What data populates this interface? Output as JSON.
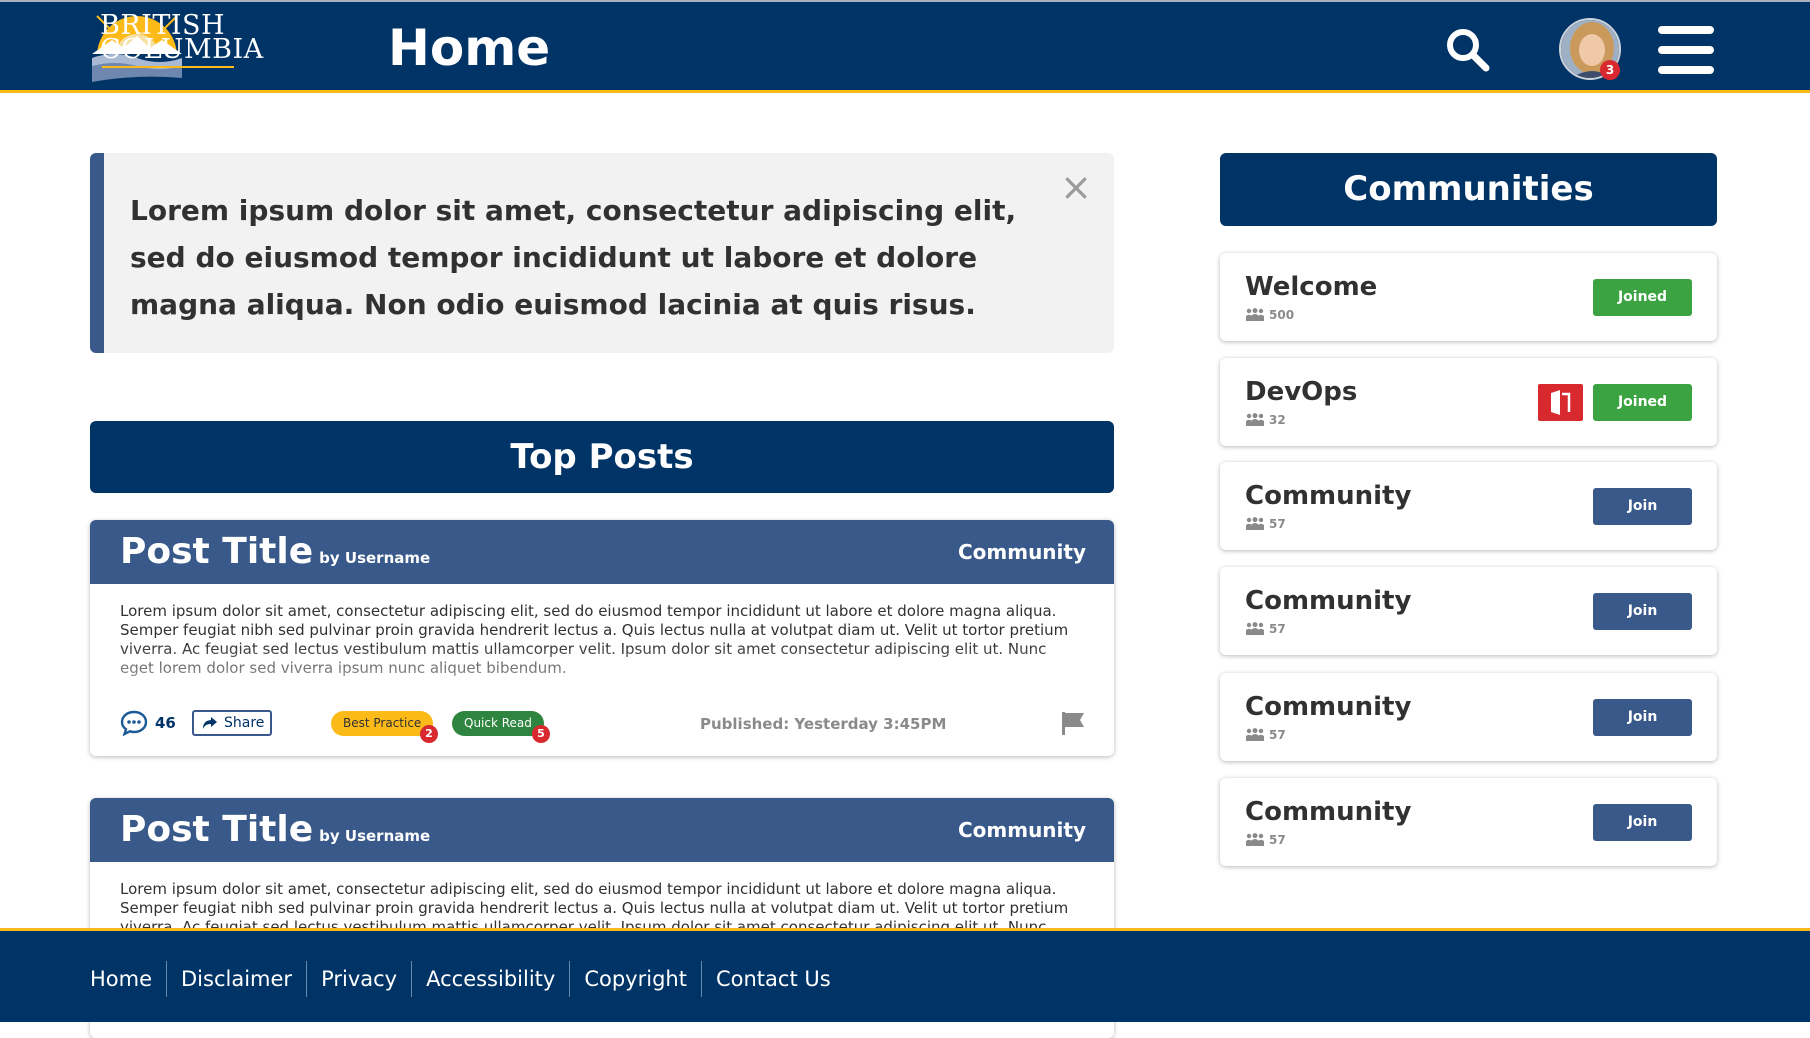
{
  "header": {
    "logo_line1": "BRITISH",
    "logo_line2": "COLUMBIA",
    "title": "Home",
    "notification_count": "3"
  },
  "banner": {
    "text": "Lorem ipsum dolor sit amet, consectetur adipiscing elit, sed do eiusmod tempor incididunt ut labore et dolore magna aliqua. Non odio euismod lacinia at quis risus.",
    "close_label": "×"
  },
  "top_posts": {
    "heading": "Top Posts",
    "posts": [
      {
        "title": "Post Title",
        "by": "by Username",
        "community": "Community",
        "body": "Lorem ipsum dolor sit amet, consectetur adipiscing elit, sed do eiusmod tempor incididunt ut labore et dolore magna aliqua. Semper feugiat nibh sed pulvinar proin gravida hendrerit lectus a. Quis lectus nulla at volutpat diam ut. Velit ut tortor pretium viverra. Ac feugiat sed lectus vestibulum mattis ullamcorper velit. Ipsum dolor sit amet consectetur adipiscing elit ut. Nunc eget lorem dolor sed viverra ipsum nunc aliquet bibendum.",
        "comments": "46",
        "share_label": "Share",
        "tags": [
          {
            "label": "Best Practice",
            "count": "2"
          },
          {
            "label": "Quick Read",
            "count": "5"
          }
        ],
        "published": "Published: Yesterday 3:45PM"
      },
      {
        "title": "Post Title",
        "by": "by Username",
        "community": "Community",
        "body": "Lorem ipsum dolor sit amet, consectetur adipiscing elit, sed do eiusmod tempor incididunt ut labore et dolore magna aliqua. Semper feugiat nibh sed pulvinar proin gravida hendrerit lectus a. Quis lectus nulla at volutpat diam ut. Velit ut tortor pretium viverra. Ac feugiat sed lectus vestibulum mattis ullamcorper velit. Ipsum dolor sit amet consectetur adipiscing elit ut. Nunc eget lorem dolor sed viverra ipsum nunc aliquet bibendum."
      }
    ]
  },
  "communities": {
    "heading": "Communities",
    "items": [
      {
        "name": "Welcome",
        "members": "500",
        "button": "Joined"
      },
      {
        "name": "DevOps",
        "members": "32",
        "button": "Joined"
      },
      {
        "name": "Community",
        "members": "57",
        "button": "Join"
      },
      {
        "name": "Community",
        "members": "57",
        "button": "Join"
      },
      {
        "name": "Community",
        "members": "57",
        "button": "Join"
      },
      {
        "name": "Community",
        "members": "57",
        "button": "Join"
      }
    ]
  },
  "footer": {
    "links": [
      "Home",
      "Disclaimer",
      "Privacy",
      "Accessibility",
      "Copyright",
      "Contact Us"
    ]
  },
  "colors": {
    "primary": "#003366",
    "accent": "#fcba19",
    "post_header": "#38598a",
    "joined": "#3ca342",
    "danger": "#d8292f"
  }
}
